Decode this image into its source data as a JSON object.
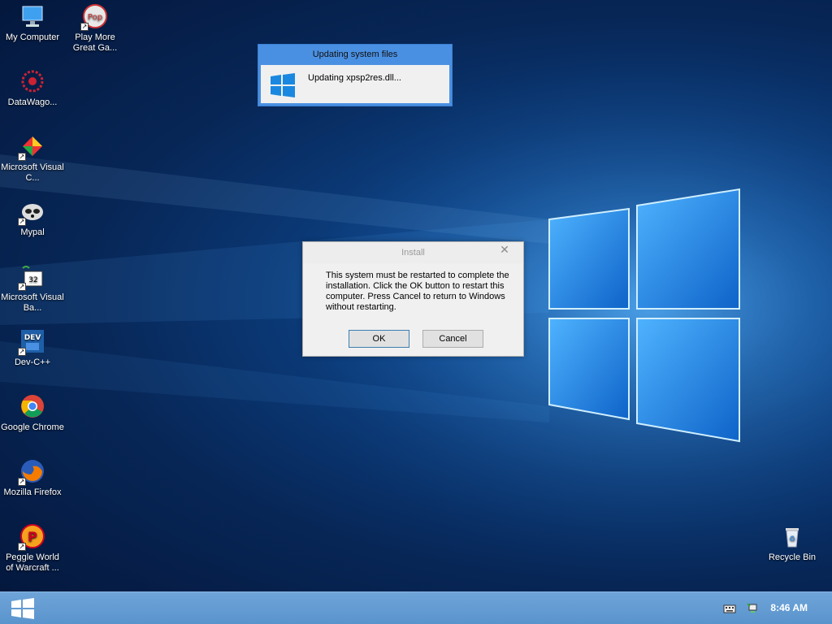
{
  "desktop": {
    "icons": [
      {
        "label": "My Computer",
        "icon": "computer-icon"
      },
      {
        "label": "Play More Great Ga...",
        "icon": "popcap-icon"
      },
      {
        "label": "DataWago...",
        "icon": "datawagon-icon"
      },
      {
        "label": "Microsoft Visual C...",
        "icon": "visual-c-icon"
      },
      {
        "label": "Mypal",
        "icon": "mypal-icon"
      },
      {
        "label": "Microsoft Visual Ba...",
        "icon": "visual-basic-icon"
      },
      {
        "label": "Dev-C++",
        "icon": "dev-cpp-icon"
      },
      {
        "label": "Google Chrome",
        "icon": "chrome-icon"
      },
      {
        "label": "Mozilla Firefox",
        "icon": "firefox-icon"
      },
      {
        "label": "Peggle World of Warcraft ...",
        "icon": "peggle-icon"
      },
      {
        "label": "Recycle Bin",
        "icon": "recycle-bin-icon"
      }
    ]
  },
  "progress_window": {
    "title": "Updating system files",
    "message": "Updating xpsp2res.dll..."
  },
  "install_dialog": {
    "title": "Install",
    "close_label": "✕",
    "message": "This system must be restarted to complete the installation. Click the OK button to restart this computer. Press Cancel to return to Windows without restarting.",
    "ok_label": "OK",
    "cancel_label": "Cancel"
  },
  "taskbar": {
    "clock": "8:46 AM"
  },
  "colors": {
    "accent": "#4a90e2",
    "taskbar": "#5a94cd"
  }
}
